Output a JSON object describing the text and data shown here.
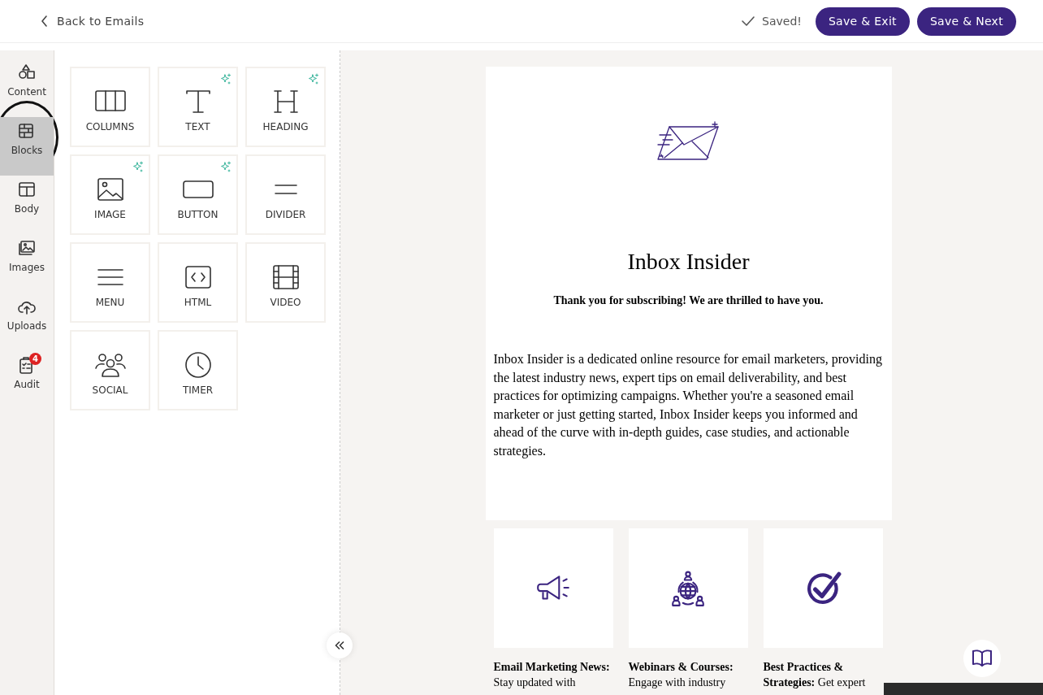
{
  "header": {
    "back_link": "Back to Emails",
    "status": "Saved!",
    "buttons": [
      "Save & Exit",
      "Save & Next"
    ]
  },
  "rail": [
    {
      "label": "Content",
      "selected": false
    },
    {
      "label": "Blocks",
      "selected": true
    },
    {
      "label": "Body",
      "selected": false
    },
    {
      "label": "Images",
      "selected": false
    },
    {
      "label": "Uploads",
      "selected": false
    },
    {
      "label": "Audit",
      "selected": false,
      "badge": "4"
    }
  ],
  "blocks": [
    {
      "label": "COLUMNS",
      "ai": false
    },
    {
      "label": "TEXT",
      "ai": true
    },
    {
      "label": "HEADING",
      "ai": true
    },
    {
      "label": "IMAGE",
      "ai": true
    },
    {
      "label": "BUTTON",
      "ai": true
    },
    {
      "label": "DIVIDER",
      "ai": false
    },
    {
      "label": "MENU",
      "ai": false
    },
    {
      "label": "HTML",
      "ai": false
    },
    {
      "label": "VIDEO",
      "ai": false
    },
    {
      "label": "SOCIAL",
      "ai": false
    },
    {
      "label": "TIMER",
      "ai": false
    }
  ],
  "email": {
    "title": "Inbox Insider",
    "subtitle": "Thank you for subscribing! We are thrilled to have you.",
    "intro": "Inbox Insider is a dedicated online resource for email marketers, providing the latest industry news, expert tips on email deliverability, and best practices for optimizing campaigns. Whether you're a seasoned email marketer or just getting started, Inbox Insider keeps you informed and ahead of the curve with in-depth guides, case studies, and actionable strategies.",
    "features": [
      {
        "text": "**Email Marketing News:** Stay updated with"
      },
      {
        "text": "**Webinars & Courses:** Engage with industry"
      },
      {
        "text": "**Best Practices & Strategies:** Get expert"
      }
    ]
  }
}
